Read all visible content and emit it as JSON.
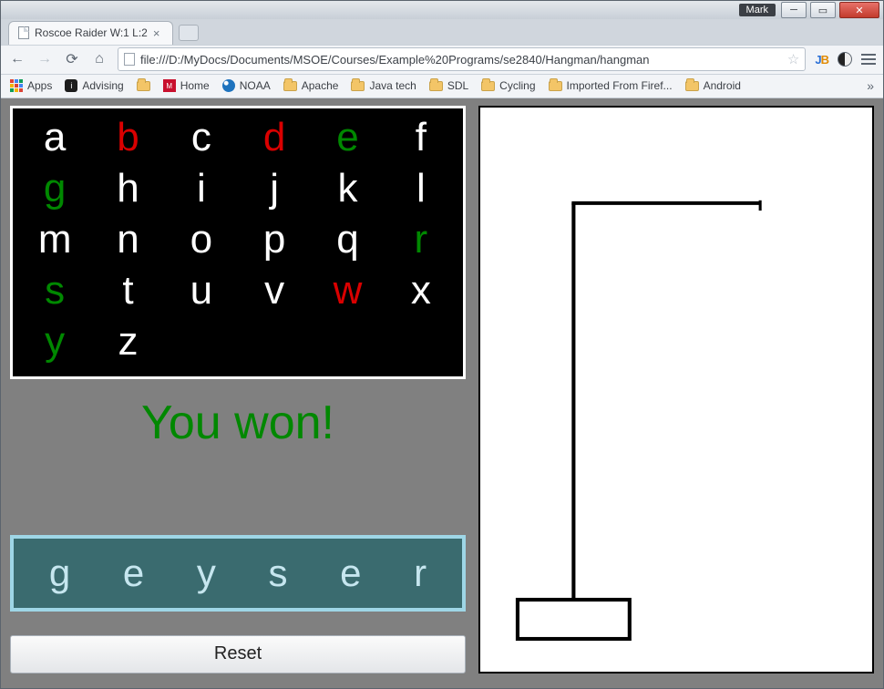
{
  "window": {
    "user_badge": "Mark"
  },
  "tab": {
    "title": "Roscoe Raider W:1 L:2"
  },
  "omnibox": {
    "url": "file:///D:/MyDocs/Documents/MSOE/Courses/Example%20Programs/se2840/Hangman/hangman"
  },
  "bookmarks": {
    "apps": "Apps",
    "items": [
      "Advising",
      "Home",
      "NOAA",
      "Apache",
      "Java tech",
      "SDL",
      "Cycling",
      "Imported From Firef...",
      "Android"
    ]
  },
  "game": {
    "alphabet": [
      {
        "ch": "a",
        "state": "unused"
      },
      {
        "ch": "b",
        "state": "wrong"
      },
      {
        "ch": "c",
        "state": "unused"
      },
      {
        "ch": "d",
        "state": "wrong"
      },
      {
        "ch": "e",
        "state": "correct"
      },
      {
        "ch": "f",
        "state": "unused"
      },
      {
        "ch": "g",
        "state": "correct"
      },
      {
        "ch": "h",
        "state": "unused"
      },
      {
        "ch": "i",
        "state": "unused"
      },
      {
        "ch": "j",
        "state": "unused"
      },
      {
        "ch": "k",
        "state": "unused"
      },
      {
        "ch": "l",
        "state": "unused"
      },
      {
        "ch": "m",
        "state": "unused"
      },
      {
        "ch": "n",
        "state": "unused"
      },
      {
        "ch": "o",
        "state": "unused"
      },
      {
        "ch": "p",
        "state": "unused"
      },
      {
        "ch": "q",
        "state": "unused"
      },
      {
        "ch": "r",
        "state": "correct"
      },
      {
        "ch": "s",
        "state": "correct"
      },
      {
        "ch": "t",
        "state": "unused"
      },
      {
        "ch": "u",
        "state": "unused"
      },
      {
        "ch": "v",
        "state": "unused"
      },
      {
        "ch": "w",
        "state": "wrong"
      },
      {
        "ch": "x",
        "state": "unused"
      },
      {
        "ch": "y",
        "state": "correct"
      },
      {
        "ch": "z",
        "state": "unused"
      }
    ],
    "status_message": "You won!",
    "word_letters": [
      "g",
      "e",
      "y",
      "s",
      "e",
      "r"
    ],
    "reset_label": "Reset",
    "score": {
      "wins": 1,
      "losses": 2
    },
    "wrong_guess_count": 3
  }
}
